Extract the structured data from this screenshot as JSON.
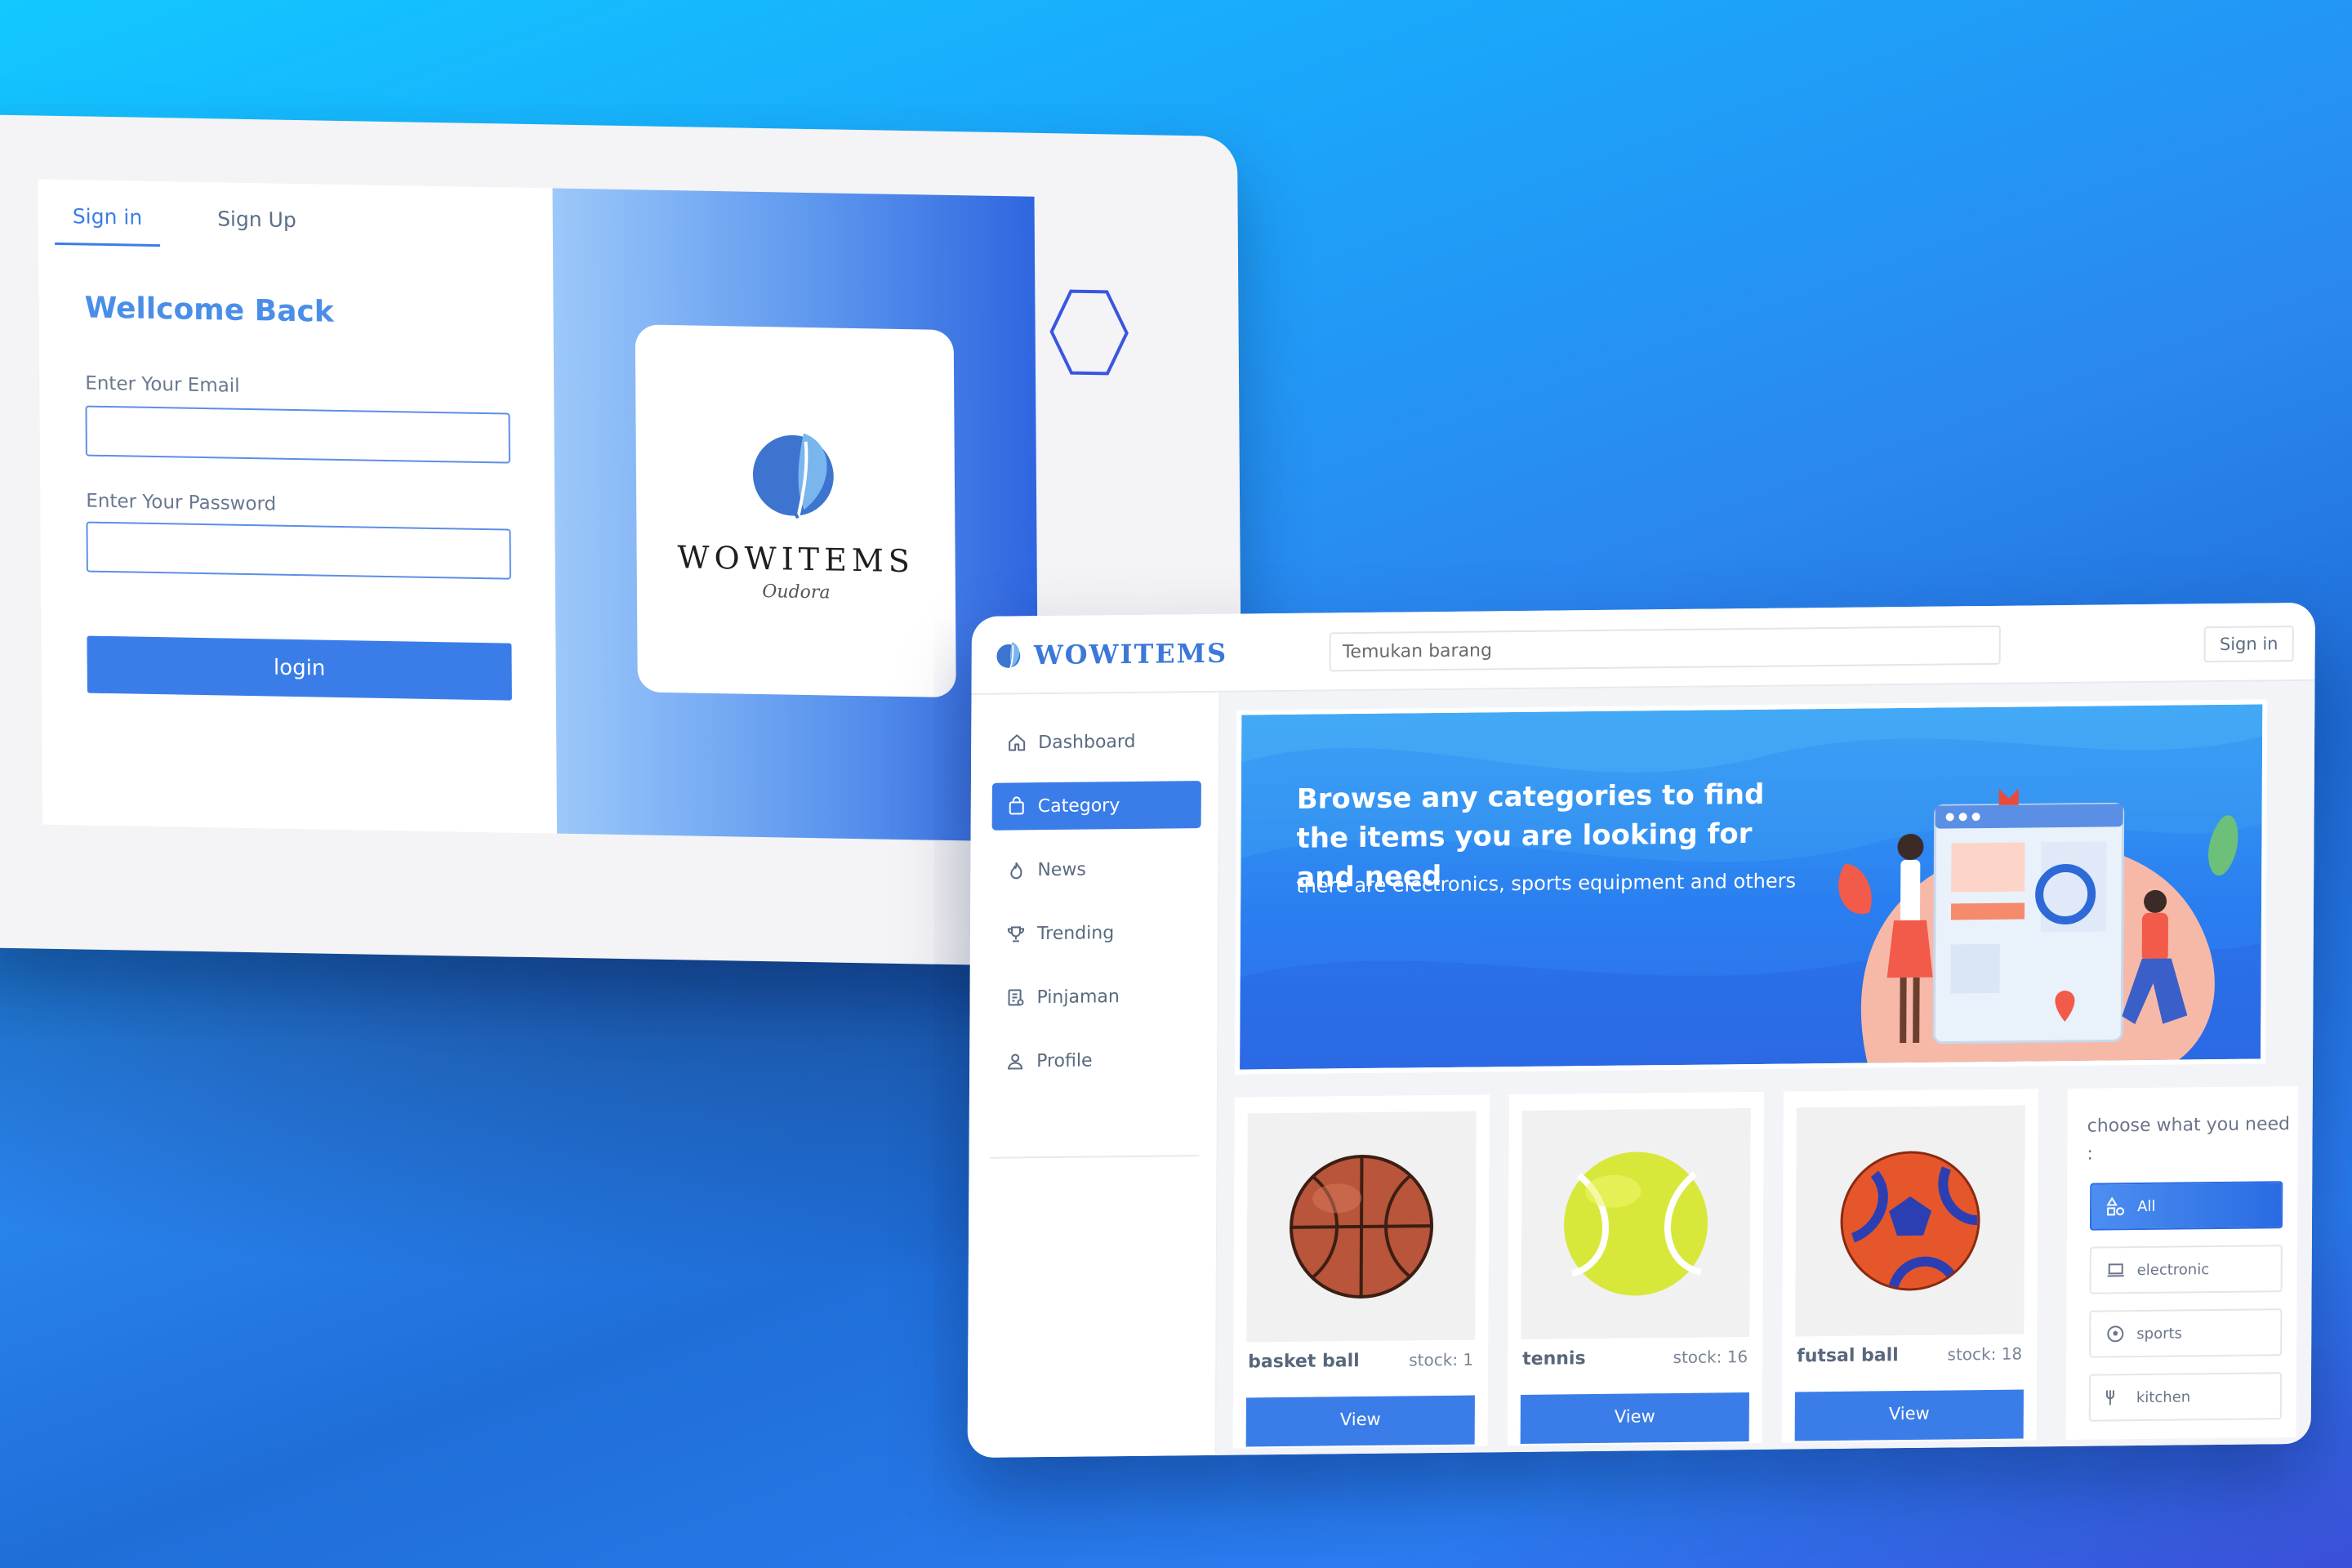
{
  "login": {
    "tabs": [
      {
        "label": "Sign in",
        "active": true
      },
      {
        "label": "Sign Up",
        "active": false
      }
    ],
    "heading": "Wellcome Back",
    "email_label": "Enter Your Email",
    "email_value": "",
    "password_label": "Enter Your Password",
    "password_value": "",
    "login_button": "login",
    "brand_name": "WOWITEMS",
    "brand_tagline": "Oudora"
  },
  "app": {
    "logo_text": "WOWITEMS",
    "search_placeholder": "Temukan barang",
    "signin_label": "Sign in",
    "sidebar": [
      {
        "label": "Dashboard",
        "icon": "home-icon",
        "active": false
      },
      {
        "label": "Category",
        "icon": "shopping-bag-icon",
        "active": true
      },
      {
        "label": "News",
        "icon": "flame-icon",
        "active": false
      },
      {
        "label": "Trending",
        "icon": "trophy-icon",
        "active": false
      },
      {
        "label": "Pinjaman",
        "icon": "document-list-icon",
        "active": false
      },
      {
        "label": "Profile",
        "icon": "user-icon",
        "active": false
      }
    ],
    "banner": {
      "title": "Browse any categories to find the items you are looking for and need",
      "subtitle": "there are electronics, sports equipment and others"
    },
    "products": [
      {
        "name": "basket ball",
        "stock": "stock: 1",
        "button": "View",
        "image": "basketball-image"
      },
      {
        "name": "tennis",
        "stock": "stock: 16",
        "button": "View",
        "image": "tennis-ball-image"
      },
      {
        "name": "futsal ball",
        "stock": "stock: 18",
        "button": "View",
        "image": "futsal-ball-image"
      }
    ],
    "filter": {
      "title": "choose what you need :",
      "options": [
        {
          "label": "All",
          "icon": "shapes-icon",
          "active": true
        },
        {
          "label": "electronic",
          "icon": "laptop-icon",
          "active": false
        },
        {
          "label": "sports",
          "icon": "soccer-ball-icon",
          "active": false
        },
        {
          "label": "kitchen",
          "icon": "kitchen-icon",
          "active": false
        }
      ]
    }
  },
  "colors": {
    "primary": "#3b7de8",
    "background_top": "#12c8ff",
    "background_bottom": "#3b4fd6"
  }
}
